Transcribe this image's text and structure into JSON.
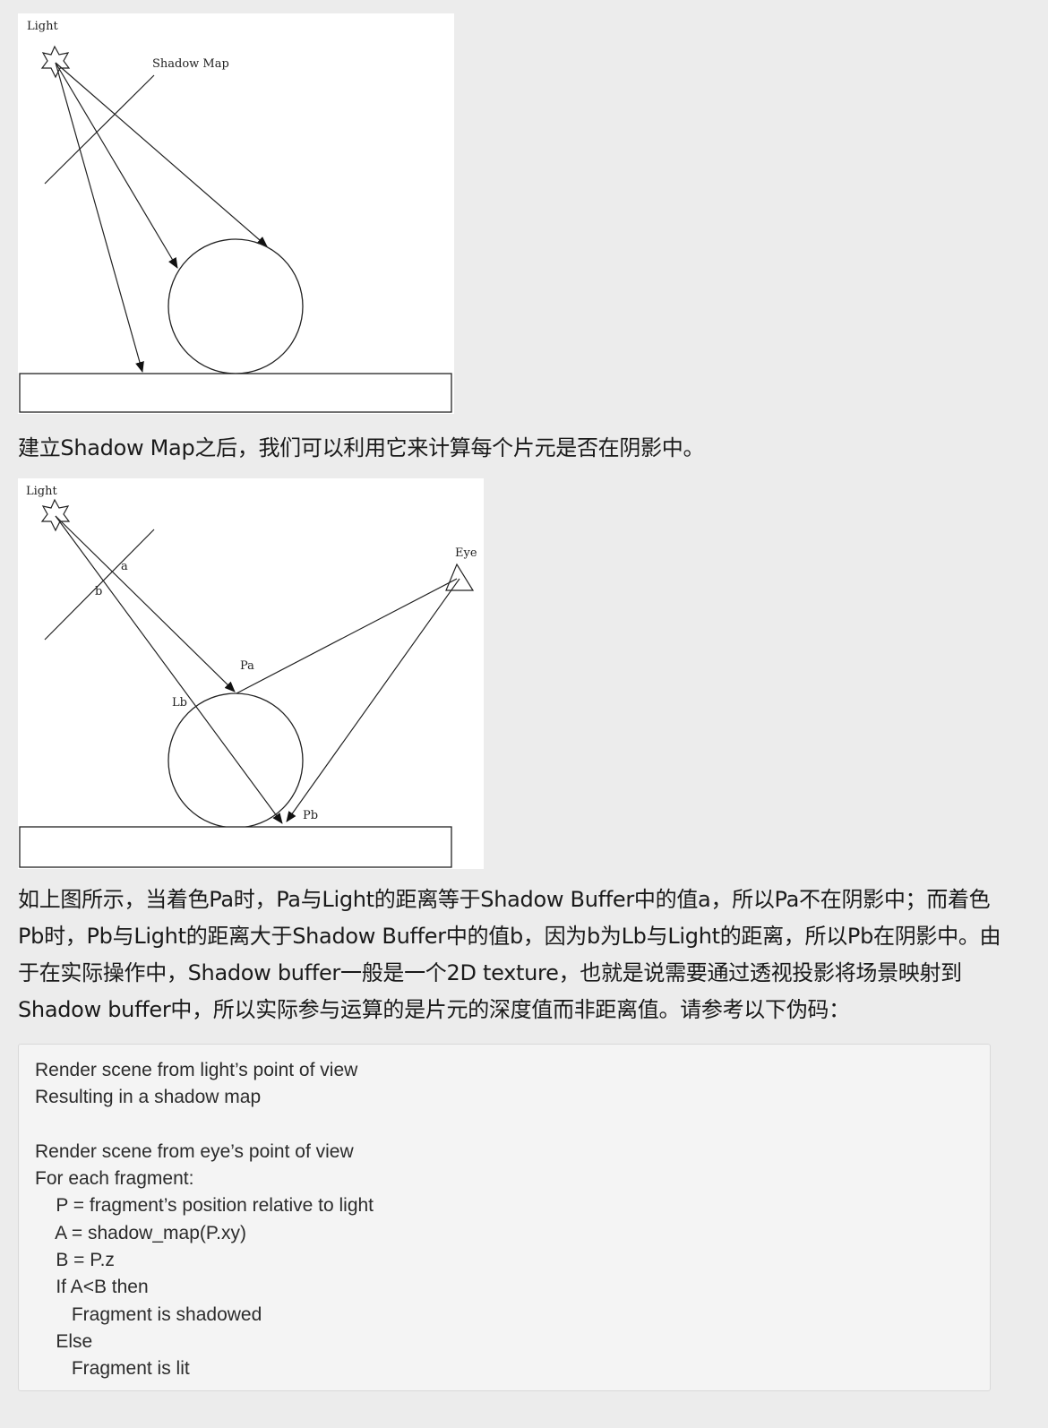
{
  "figure1": {
    "labels": {
      "light": "Light",
      "shadow_map": "Shadow Map"
    }
  },
  "paragraph1": "建立Shadow Map之后，我们可以利用它来计算每个片元是否在阴影中。",
  "figure2": {
    "labels": {
      "light": "Light",
      "eye": "Eye",
      "a": "a",
      "b": "b",
      "pa": "Pa",
      "pb": "Pb",
      "lb": "Lb"
    }
  },
  "paragraph2": {
    "lines": [
      "如上图所示，当着色Pa时，Pa与Light的距离等于Shadow Buffer中的值a，所以Pa不在阴影中；而着色",
      "Pb时，Pb与Light的距离大于Shadow Buffer中的值b，因为b为Lb与Light的距离，所以Pb在阴影中。由",
      "于在实际操作中，Shadow buffer一般是一个2D texture，也就是说需要通过透视投影将场景映射到",
      "Shadow buffer中，所以实际参与运算的是片元的深度值而非距离值。请参考以下伪码："
    ]
  },
  "pseudocode": {
    "lines": [
      "Render scene from light’s point of view",
      "Resulting in a shadow map",
      "",
      "Render scene from eye’s point of view",
      "For each fragment:",
      "    P = fragment’s position relative to light",
      "    A = shadow_map(P.xy)",
      "    B = P.z",
      "    If A<B then",
      "       Fragment is shadowed",
      "    Else",
      "       Fragment is lit"
    ]
  }
}
